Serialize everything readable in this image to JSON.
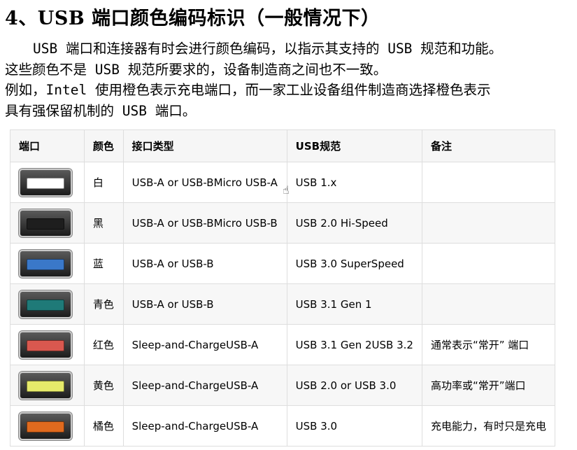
{
  "heading": "4、USB 端口颜色编码标识（一般情况下）",
  "paragraph1": {
    "line1": "USB 端口和连接器有时会进行颜色编码，以指示其支持的 USB 规范和功能。",
    "line2": "这些颜色不是 USB 规范所要求的，设备制造商之间也不一致。"
  },
  "paragraph2": {
    "line1": "例如，Intel 使用橙色表示充电端口，而一家工业设备组件制造商选择橙色表示",
    "line2": "具有强保留机制的 USB 端口。"
  },
  "table": {
    "headers": [
      "端口",
      "颜色",
      "接口类型",
      "USB规范",
      "备注"
    ],
    "rows": [
      {
        "color_name": "白",
        "tongue_color": "#ffffff",
        "type": "USB-A or USB-BMicro USB-A",
        "spec": "USB 1.x",
        "note": ""
      },
      {
        "color_name": "黑",
        "tongue_color": "#1e1e1e",
        "type": "USB-A or USB-BMicro USB-B",
        "spec": "USB 2.0 Hi-Speed",
        "note": ""
      },
      {
        "color_name": "蓝",
        "tongue_color": "#3a78c9",
        "type": "USB-A or USB-B",
        "spec": "USB 3.0 SuperSpeed",
        "note": ""
      },
      {
        "color_name": "青色",
        "tongue_color": "#1f7a78",
        "type": "USB-A or USB-B",
        "spec": "USB 3.1 Gen 1",
        "note": ""
      },
      {
        "color_name": "红色",
        "tongue_color": "#d9584f",
        "type": "Sleep-and-ChargeUSB-A",
        "spec": "USB 3.1 Gen 2USB 3.2",
        "note": "通常表示“常开” 端口"
      },
      {
        "color_name": "黄色",
        "tongue_color": "#e6ea6a",
        "type": "Sleep-and-ChargeUSB-A",
        "spec": "USB 2.0 or USB 3.0",
        "note": "高功率或“常开”端口"
      },
      {
        "color_name": "橘色",
        "tongue_color": "#e06a1e",
        "type": "Sleep-and-ChargeUSB-A",
        "spec": "USB 3.0",
        "note": "充电能力，有时只是充电"
      }
    ]
  },
  "cursor_icon": "hand-pointer-icon"
}
